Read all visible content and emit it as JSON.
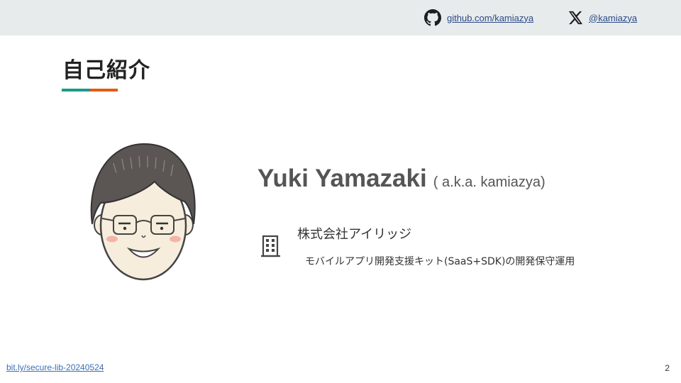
{
  "header": {
    "github_icon": "github-icon",
    "github_link": "github.com/kamiazya",
    "x_icon": "x-logo-icon",
    "x_link": "@kamiazya"
  },
  "slide": {
    "title": "自己紹介",
    "accent_colors": [
      "#1a9a8a",
      "#e35a14"
    ],
    "profile": {
      "name": "Yuki Yamazaki",
      "aka": "( a.k.a. kamiazya)",
      "company_icon": "building-icon",
      "company": "株式会社アイリッジ",
      "description": "モバイルアプリ開発支援キット(SaaS+SDK)の開発保守運用"
    }
  },
  "footer": {
    "link": "bit.ly/secure-lib-20240524",
    "page_number": "2"
  }
}
